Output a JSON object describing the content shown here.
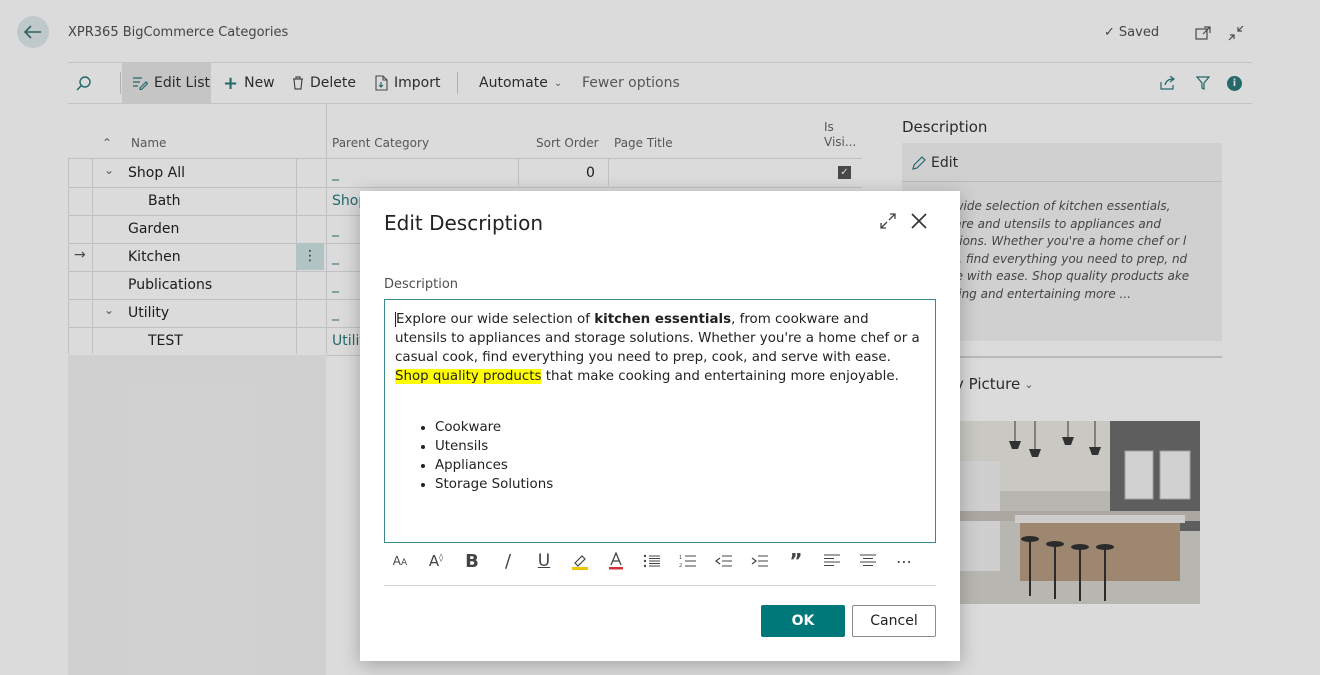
{
  "header": {
    "title": "XPR365 BigCommerce Categories",
    "saved": "Saved"
  },
  "toolbar": {
    "edit_list": "Edit List",
    "new": "New",
    "delete": "Delete",
    "import": "Import",
    "automate": "Automate",
    "fewer_options": "Fewer options"
  },
  "grid": {
    "columns": [
      "Name",
      "Parent Category",
      "Sort Order",
      "Page Title",
      "Is Visi..."
    ],
    "rows": [
      {
        "name": "Shop All",
        "parent": "_",
        "sort": "0",
        "visible": true
      },
      {
        "name": "Bath",
        "parent": "Shop"
      },
      {
        "name": "Garden",
        "parent": "_"
      },
      {
        "name": "Kitchen",
        "parent": "_"
      },
      {
        "name": "Publications",
        "parent": "_"
      },
      {
        "name": "Utility",
        "parent": "_"
      },
      {
        "name": "TEST",
        "parent": "Utilit"
      }
    ]
  },
  "factbox": {
    "title": "Description",
    "edit": "Edit",
    "text": "our wide selection of kitchen essentials, okware and utensils to appliances and solutions. Whether you're a home chef or l cook, find everything you need to prep, nd serve with ease. Shop quality products ake cooking and entertaining more ...",
    "picture_title": "y Picture"
  },
  "dialog": {
    "title": "Edit Description",
    "field_label": "Description",
    "text_p1": "Explore our wide selection of ",
    "text_bold": "kitchen essentials",
    "text_p2": ", from cookware and utensils to appliances and storage solutions. Whether you're a home chef or a casual cook, find everything you need to prep, cook, and serve with ease. ",
    "text_highlight": "Shop quality products",
    "text_p3": " that make cooking and entertaining more enjoyable.",
    "bullets": [
      "Cookware",
      "Utensils",
      "Appliances",
      "Storage Solutions"
    ],
    "ok": "OK",
    "cancel": "Cancel"
  },
  "colors": {
    "accent": "#00787a",
    "highlight": "#ffff00",
    "editor_border": "#3a8a8c"
  }
}
